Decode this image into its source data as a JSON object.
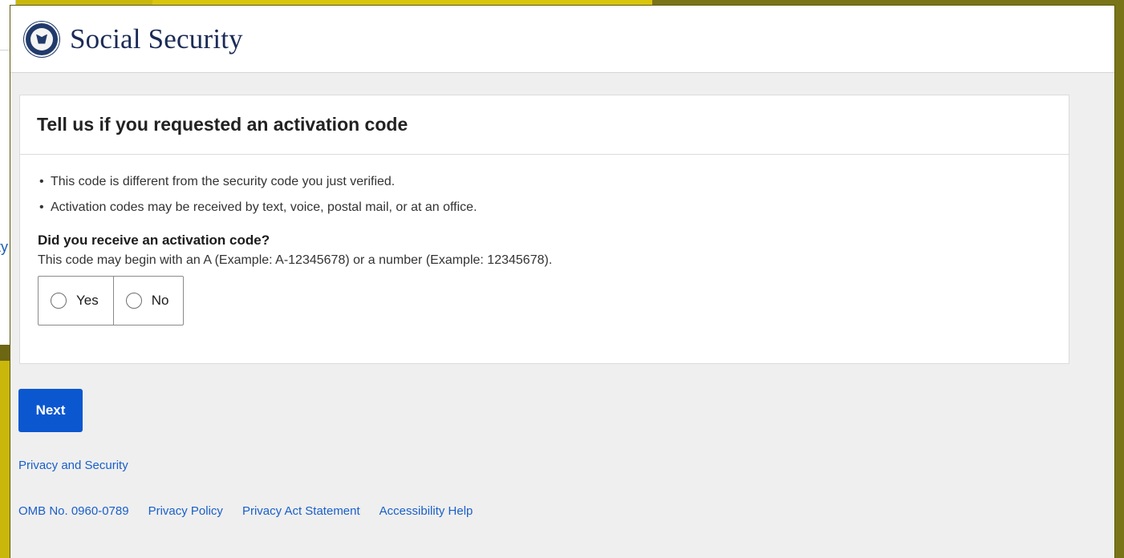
{
  "brand": {
    "name": "Social Security"
  },
  "card": {
    "title": "Tell us if you requested an activation code",
    "bullets": [
      "This code is different from the security code you just verified.",
      "Activation codes may be received by text, voice, postal mail, or at an office."
    ],
    "question": "Did you receive an activation code?",
    "hint": "This code may begin with an A (Example: A-12345678) or a number (Example: 12345678).",
    "options": [
      "Yes",
      "No"
    ]
  },
  "next_label": "Next",
  "privacy_security": "Privacy and Security",
  "footer": {
    "omb": "OMB No. 0960-0789",
    "links": [
      "Privacy Policy",
      "Privacy Act Statement",
      "Accessibility Help"
    ]
  },
  "background": {
    "partial_char": "ty"
  },
  "colors": {
    "brand_text": "#1b2b56",
    "primary_button": "#0b57d0",
    "link": "#1a5fc8",
    "page_bg": "#efefef"
  }
}
